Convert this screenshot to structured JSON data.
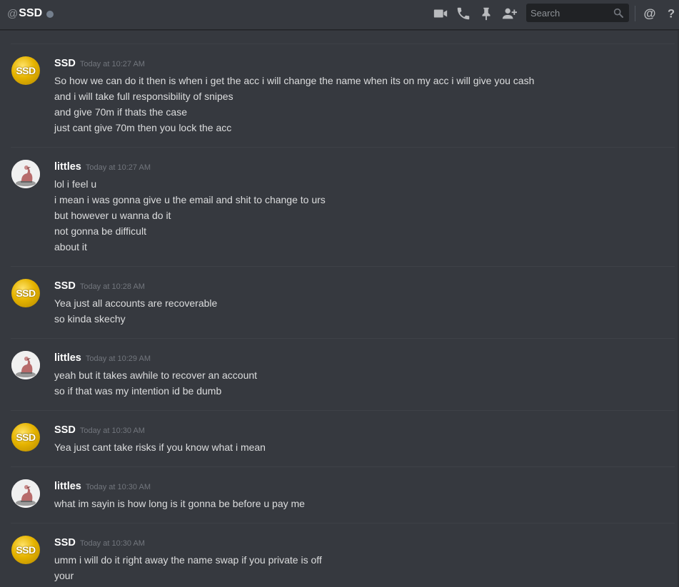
{
  "header": {
    "at_symbol": "@",
    "channel_name": "SSD",
    "search_placeholder": "Search",
    "icons": [
      "video-call-icon",
      "voice-call-icon",
      "pin-icon",
      "add-friend-icon",
      "search-icon",
      "mention-icon",
      "help-icon"
    ],
    "help_label": "?"
  },
  "messages": [
    {
      "author": "SSD",
      "avatar_text": "SSD",
      "timestamp": "Today at 10:27 AM",
      "lines": [
        "So how we can do it then is when i get the acc i will change the name when its on my acc i will give you cash",
        "and i will take full responsibility of snipes",
        "and give 70m if thats the case",
        "just cant give 70m then you lock the acc"
      ]
    },
    {
      "author": "littles",
      "timestamp": "Today at 10:27 AM",
      "lines": [
        "lol i feel u",
        "i mean i was gonna give u the email and shit to change to urs",
        "but however u wanna do it",
        "not gonna be difficult",
        "about it"
      ]
    },
    {
      "author": "SSD",
      "avatar_text": "SSD",
      "timestamp": "Today at 10:28 AM",
      "lines": [
        "Yea just all accounts are recoverable",
        "so kinda skechy"
      ]
    },
    {
      "author": "littles",
      "timestamp": "Today at 10:29 AM",
      "lines": [
        "yeah but it takes awhile to recover an account",
        "so if that was my intention id be dumb"
      ]
    },
    {
      "author": "SSD",
      "avatar_text": "SSD",
      "timestamp": "Today at 10:30 AM",
      "lines": [
        "Yea just cant take risks if you know what i mean"
      ]
    },
    {
      "author": "littles",
      "timestamp": "Today at 10:30 AM",
      "lines": [
        "what im sayin is how long is it gonna be before u pay me"
      ]
    },
    {
      "author": "SSD",
      "avatar_text": "SSD",
      "timestamp": "Today at 10:30 AM",
      "lines": [
        "umm i will do it right away the name swap if you private is off",
        "your"
      ]
    }
  ],
  "colors": {
    "background": "#36393f",
    "header_text": "#ffffff",
    "timestamp": "#72767d",
    "message_text": "#dcddde",
    "avatar_gold": "#e6b400"
  }
}
